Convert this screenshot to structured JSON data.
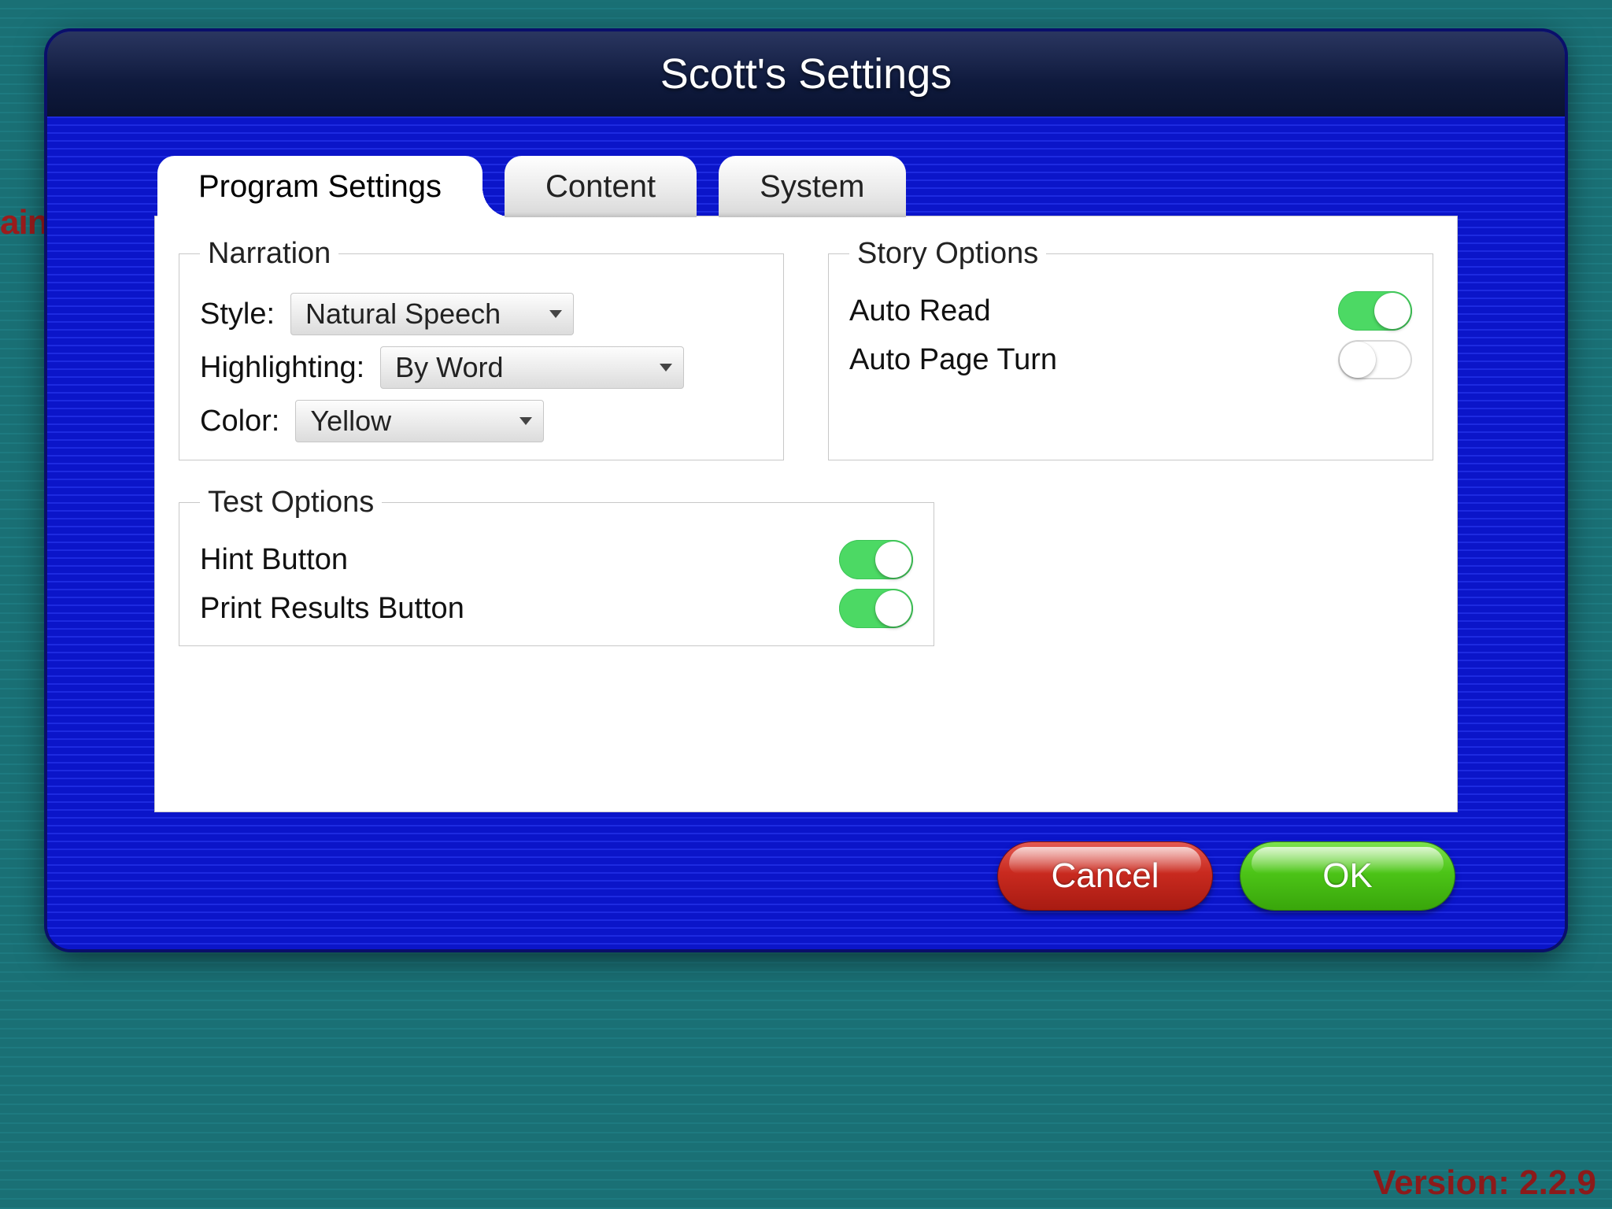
{
  "background": {
    "left_cut_text": "ain",
    "version_label": "Version: 2.2.9"
  },
  "dialog": {
    "title": "Scott's Settings",
    "tabs": [
      {
        "label": "Program Settings",
        "active": true
      },
      {
        "label": "Content",
        "active": false
      },
      {
        "label": "System",
        "active": false
      }
    ],
    "groups": {
      "narration": {
        "legend": "Narration",
        "style_label": "Style:",
        "style_value": "Natural Speech",
        "highlighting_label": "Highlighting:",
        "highlighting_value": "By Word",
        "color_label": "Color:",
        "color_value": "Yellow"
      },
      "story": {
        "legend": "Story Options",
        "auto_read_label": "Auto Read",
        "auto_read_on": true,
        "auto_page_turn_label": "Auto Page Turn",
        "auto_page_turn_on": false
      },
      "test": {
        "legend": "Test Options",
        "hint_label": "Hint Button",
        "hint_on": true,
        "print_label": "Print Results Button",
        "print_on": true
      }
    },
    "buttons": {
      "cancel": "Cancel",
      "ok": "OK"
    }
  }
}
